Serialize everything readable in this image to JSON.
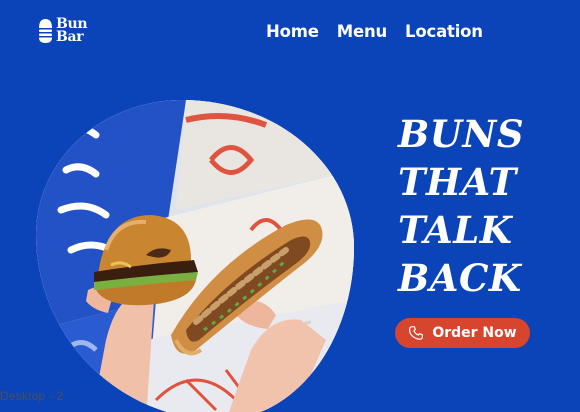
{
  "brand": {
    "line1": "Bun",
    "line2": "Bar"
  },
  "nav": {
    "items": [
      {
        "label": "Home"
      },
      {
        "label": "Menu"
      },
      {
        "label": "Location"
      }
    ]
  },
  "hero": {
    "headline": [
      "BUNS",
      "THAT",
      "TALK",
      "BACK"
    ],
    "cta_label": "Order Now",
    "cta_icon": "phone-icon",
    "image_subject": "burger-and-sandwich-photo"
  },
  "colors": {
    "background": "#0a44b8",
    "cta": "#d8452f",
    "text": "#ffffff"
  },
  "editor": {
    "frame_label": "Desktop - 2"
  }
}
